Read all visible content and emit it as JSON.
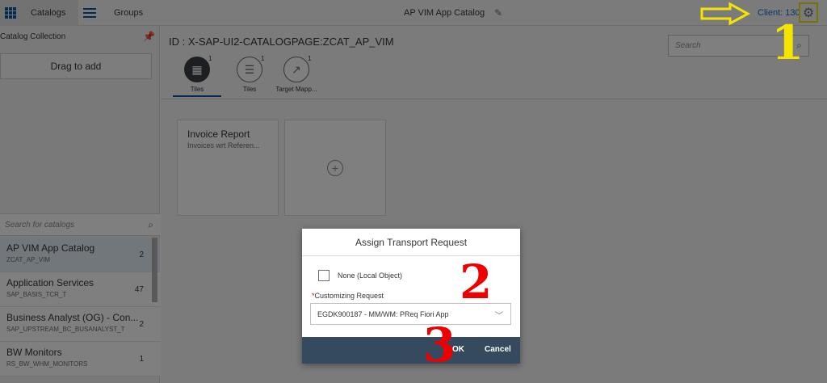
{
  "shell": {
    "catalogs_label": "Catalogs",
    "groups_label": "Groups",
    "app_title": "AP VIM App Catalog",
    "client_label": "Client: 130"
  },
  "left_panel": {
    "header": "Catalog Collection",
    "drag_label": "Drag to add",
    "search_placeholder": "Search for catalogs",
    "catalogs": [
      {
        "title": "AP VIM App Catalog",
        "id": "ZCAT_AP_VIM",
        "count": "2",
        "selected": true
      },
      {
        "title": "Application Services",
        "id": "SAP_BASIS_TCR_T",
        "count": "47",
        "selected": false
      },
      {
        "title": "Business Analyst (OG) - Con...",
        "id": "SAP_UPSTREAM_BC_BUSANALYST_T",
        "count": "2",
        "selected": false
      },
      {
        "title": "BW Monitors",
        "id": "RS_BW_WHM_MONITORS",
        "count": "1",
        "selected": false
      }
    ]
  },
  "main": {
    "catalog_id": "ID : X-SAP-UI2-CATALOGPAGE:ZCAT_AP_VIM",
    "search_placeholder": "Search",
    "tabs": [
      {
        "label": "Tiles",
        "count": "1"
      },
      {
        "label": "Tiles",
        "count": "1"
      },
      {
        "label": "Target Mapp...",
        "count": "1"
      }
    ],
    "tile": {
      "title": "Invoice Report",
      "subtitle": "Invoices wrt Referen..."
    }
  },
  "dialog": {
    "title": "Assign Transport Request",
    "checkbox_label": "None (Local Object)",
    "required_star": "*",
    "request_label": "Customizing Request",
    "request_value": "EGDK900187 - MM/WM: PReq Fiori App",
    "ok_label": "OK",
    "cancel_label": "Cancel"
  },
  "annotations": {
    "marker_1": "1",
    "marker_2": "2",
    "marker_3": "3"
  }
}
